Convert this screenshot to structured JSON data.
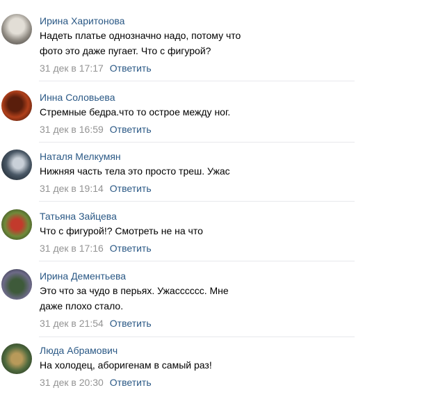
{
  "comments": [
    {
      "author": "Ирина Харитонова",
      "text_lines": [
        "Надеть платье однозначно надо, потому что",
        "фото это даже пугает. Что с фигурой?"
      ],
      "date": "31 дек в 17:17",
      "reply_label": "Ответить"
    },
    {
      "author": "Инна Соловьева",
      "text_lines": [
        "Стремные бедра.что то острое между ног."
      ],
      "date": "31 дек в 16:59",
      "reply_label": "Ответить"
    },
    {
      "author": "Наталя Мелкумян",
      "text_lines": [
        "Нижняя часть тела это просто треш. Ужас"
      ],
      "date": "31 дек в 19:14",
      "reply_label": "Ответить"
    },
    {
      "author": "Татьяна Зайцева",
      "text_lines": [
        "Что с фигурой!? Смотреть не на что"
      ],
      "date": "31 дек в 17:16",
      "reply_label": "Ответить"
    },
    {
      "author": "Ирина Дементьева",
      "text_lines": [
        "Это что за чудо в перьях. Ужасссссс. Мне",
        "даже плохо стало."
      ],
      "date": "31 дек в 21:54",
      "reply_label": "Ответить"
    },
    {
      "author": "Люда Абрамович",
      "text_lines": [
        "На холодец, аборигенам в самый раз!"
      ],
      "date": "31 дек в 20:30",
      "reply_label": "Ответить"
    }
  ],
  "colors": {
    "author_link": "#2a5885",
    "date": "#939393",
    "separator": "#e7e8ec",
    "text": "#000000"
  }
}
